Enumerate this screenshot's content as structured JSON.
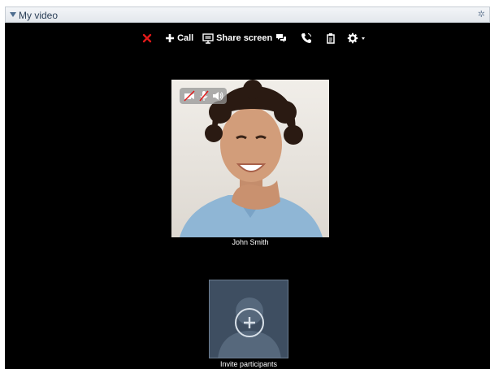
{
  "panel": {
    "title": "My video"
  },
  "toolbar": {
    "call_label": "Call",
    "share_label": "Share screen",
    "icons": [
      "close-icon",
      "plus-icon",
      "monitor-icon",
      "chat-icon",
      "phone-icon",
      "clipboard-icon",
      "gear-icon"
    ]
  },
  "participant": {
    "name": "John Smith"
  },
  "invite": {
    "label": "Invite participants"
  },
  "colors": {
    "close": "#e01a1a",
    "stage": "#000000",
    "invite_tile": "#3e4e61"
  }
}
